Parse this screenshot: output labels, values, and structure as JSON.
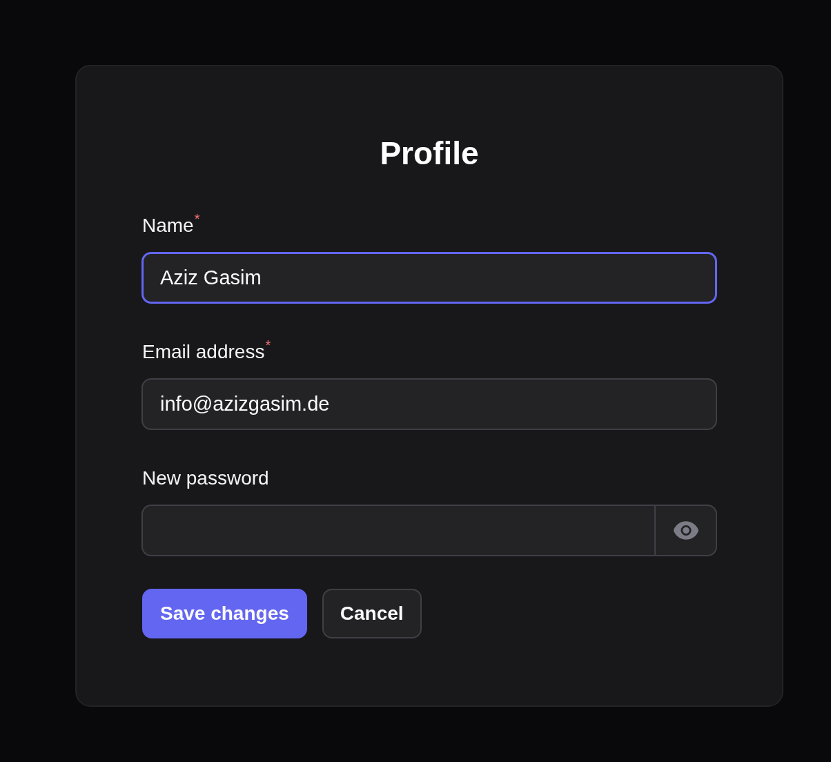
{
  "card": {
    "title": "Profile"
  },
  "fields": [
    {
      "kind": "text",
      "label": "Name",
      "required_mark": "*",
      "value": "Aziz Gasim",
      "focused": true
    },
    {
      "kind": "text",
      "label": "Email address",
      "required_mark": "*",
      "value": "info@azizgasim.de",
      "focused": false
    },
    {
      "kind": "password",
      "label": "New password",
      "focused": false
    }
  ],
  "buttons": [
    {
      "kind": "primary",
      "label": "Save changes"
    },
    {
      "kind": "secondary",
      "label": "Cancel"
    }
  ]
}
